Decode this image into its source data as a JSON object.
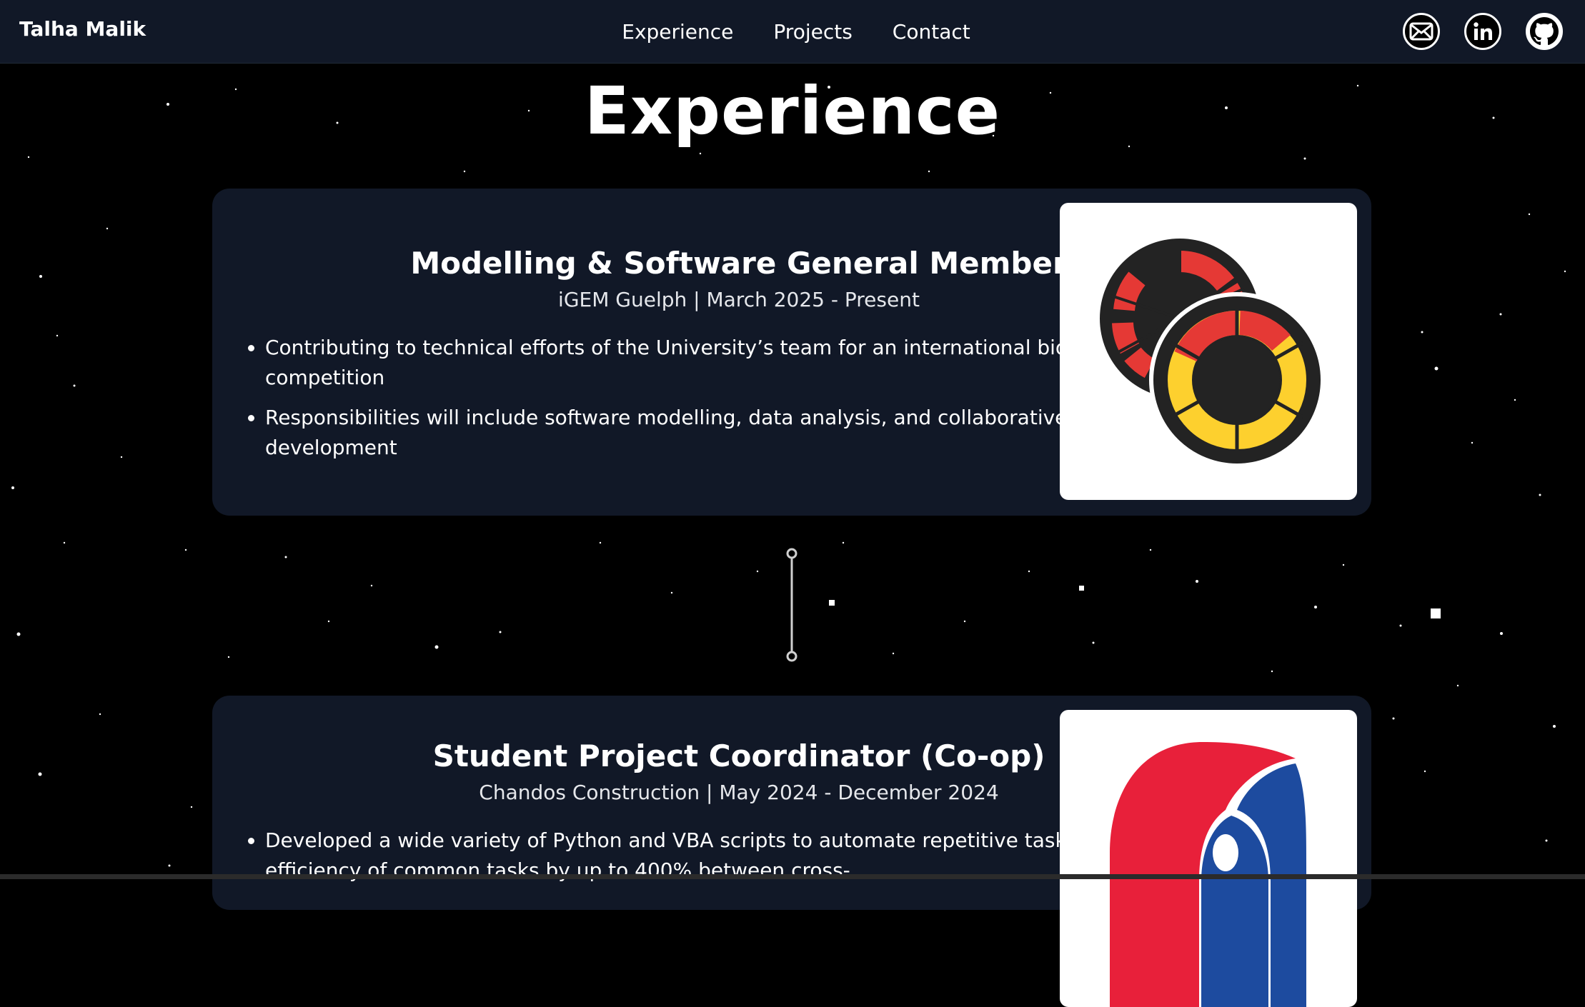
{
  "header": {
    "brand": "Talha Malik",
    "nav": [
      "Experience",
      "Projects",
      "Contact"
    ],
    "social_icons": [
      "mail-icon",
      "linkedin-icon",
      "github-icon"
    ]
  },
  "main": {
    "title": "Experience",
    "experiences": [
      {
        "title": "Modelling & Software General Member",
        "subtitle": "iGEM Guelph | March 2025 - Present",
        "bullets": [
          "Contributing to technical efforts of the University’s team for an international biological research competition",
          "Responsibilities will include software modelling, data analysis, and collaborative software development"
        ],
        "logo": "igem-guelph-logo"
      },
      {
        "title": "Student Project Coordinator (Co-op)",
        "subtitle": "Chandos Construction | May 2024 - December 2024",
        "bullets": [
          "Developed a wide variety of Python and VBA scripts to automate repetitive tasks, improving efficiency of common tasks by up to 400% between cross-"
        ],
        "logo": "chandos-construction-logo"
      }
    ]
  },
  "colors": {
    "background": "#000000",
    "card": "#111827",
    "navbar": "#111827",
    "igem_red": "#e53935",
    "igem_yellow": "#fdd02e",
    "igem_dark": "#232323",
    "chandos_red": "#e8203a",
    "chandos_blue": "#1d4b9f"
  }
}
